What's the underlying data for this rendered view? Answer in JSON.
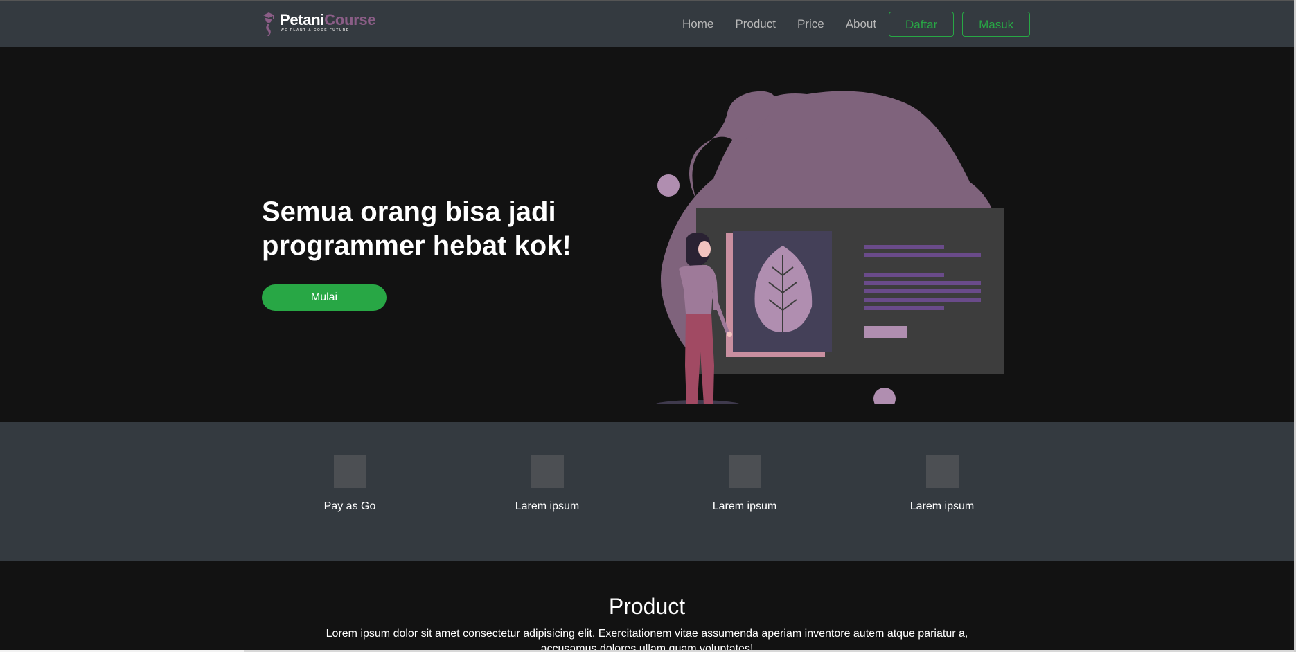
{
  "brand": {
    "name_part1": "Petani",
    "name_part2": "Course",
    "tagline": "WE PLANT & CODE FUTURE"
  },
  "nav": {
    "links": [
      "Home",
      "Product",
      "Price",
      "About"
    ],
    "register_label": "Daftar",
    "login_label": "Masuk"
  },
  "hero": {
    "title": "Semua orang bisa jadi programmer hebat kok!",
    "cta_label": "Mulai"
  },
  "features": [
    {
      "label": "Pay as Go",
      "icon": "placeholder-icon"
    },
    {
      "label": "Larem ipsum",
      "icon": "placeholder-icon"
    },
    {
      "label": "Larem ipsum",
      "icon": "placeholder-icon"
    },
    {
      "label": "Larem ipsum",
      "icon": "placeholder-icon"
    }
  ],
  "product": {
    "title": "Product",
    "description": "Lorem ipsum dolor sit amet consectetur adipisicing elit. Exercitationem vitae assumenda aperiam inventore autem atque pariatur a, accusamus dolores ullam quam voluptates!"
  },
  "colors": {
    "navbar_bg": "#343a40",
    "page_bg": "#121212",
    "accent_green": "#28a745",
    "brand_purple": "#8a5d86",
    "feature_icon_bg": "#4c4f53"
  }
}
